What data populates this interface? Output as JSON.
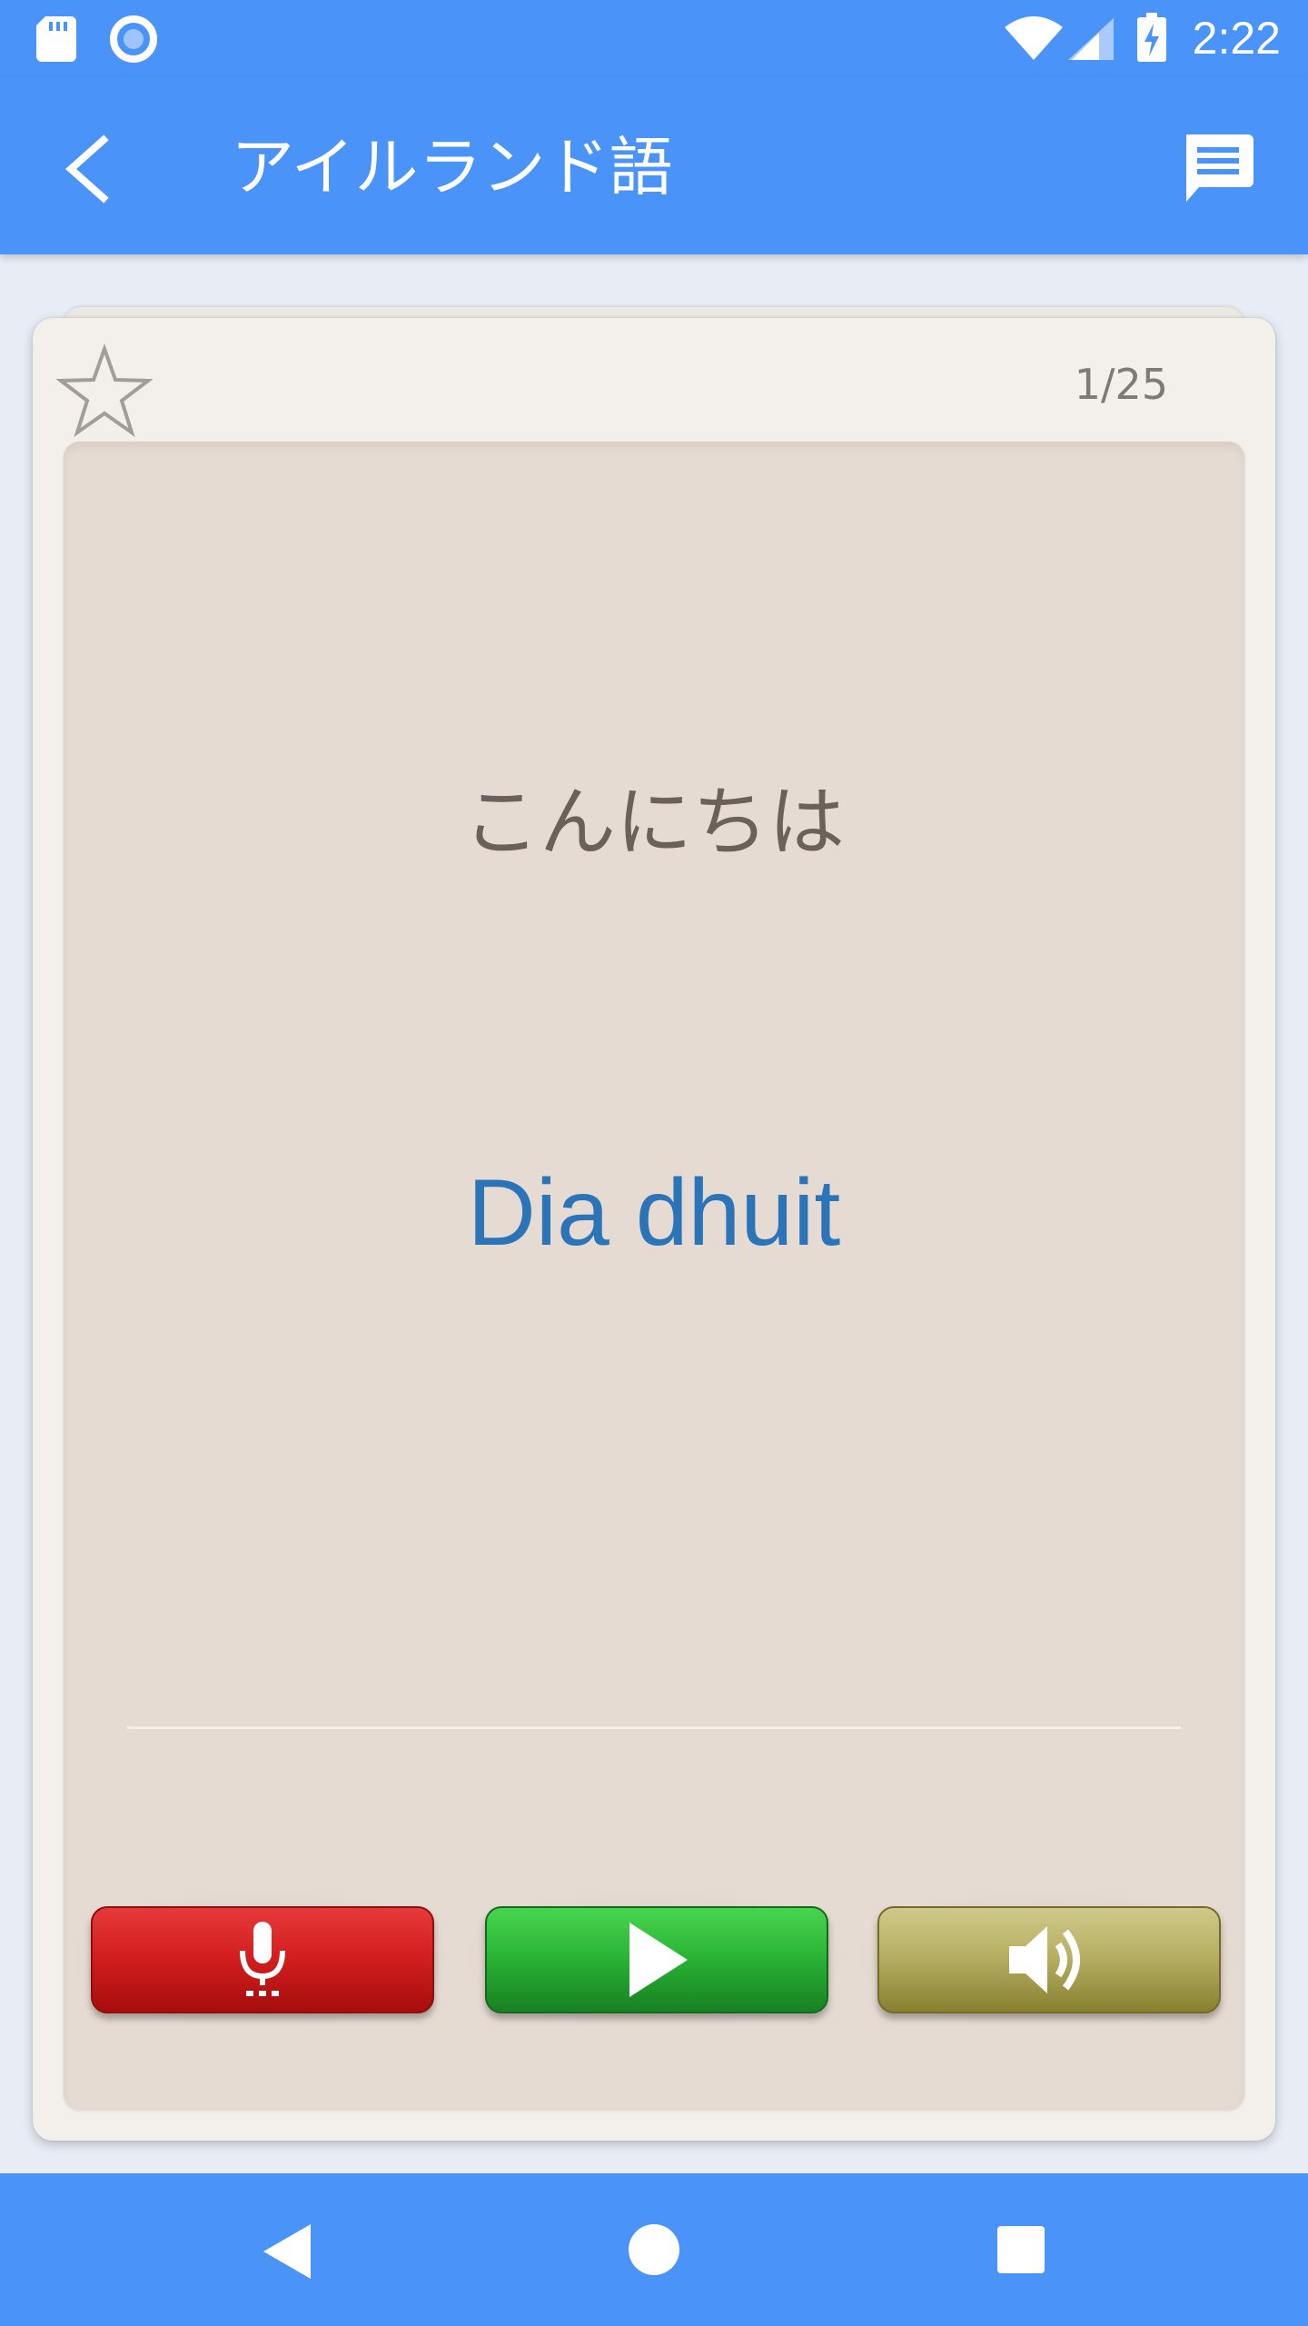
{
  "status_bar": {
    "time": "2:22",
    "icons": [
      "sd-card-icon",
      "sync-icon",
      "wifi-icon",
      "signal-icon",
      "battery-charging-icon"
    ]
  },
  "app_bar": {
    "title": "アイルランド語",
    "back_icon": "back-arrow-icon",
    "action_icon": "chat-icon"
  },
  "card": {
    "counter": "1/25",
    "native_phrase": "こんにちは",
    "foreign_phrase": "Dia dhuit",
    "favorite_icon": "star-outline-icon",
    "buttons": [
      {
        "icon": "microphone-icon",
        "color": "#d51f1f"
      },
      {
        "icon": "play-icon",
        "color": "#2bb636"
      },
      {
        "icon": "speaker-icon",
        "color": "#b8b063"
      }
    ]
  },
  "nav_bar": {
    "icons": [
      "nav-back-icon",
      "nav-home-icon",
      "nav-recent-icon"
    ]
  },
  "colors": {
    "primary": "#4a94f9",
    "background": "#e8edf5",
    "card": "#f3efea",
    "card_inner": "#e6dbd3",
    "foreign_text": "#2c74b8",
    "native_text": "#6a615b"
  }
}
